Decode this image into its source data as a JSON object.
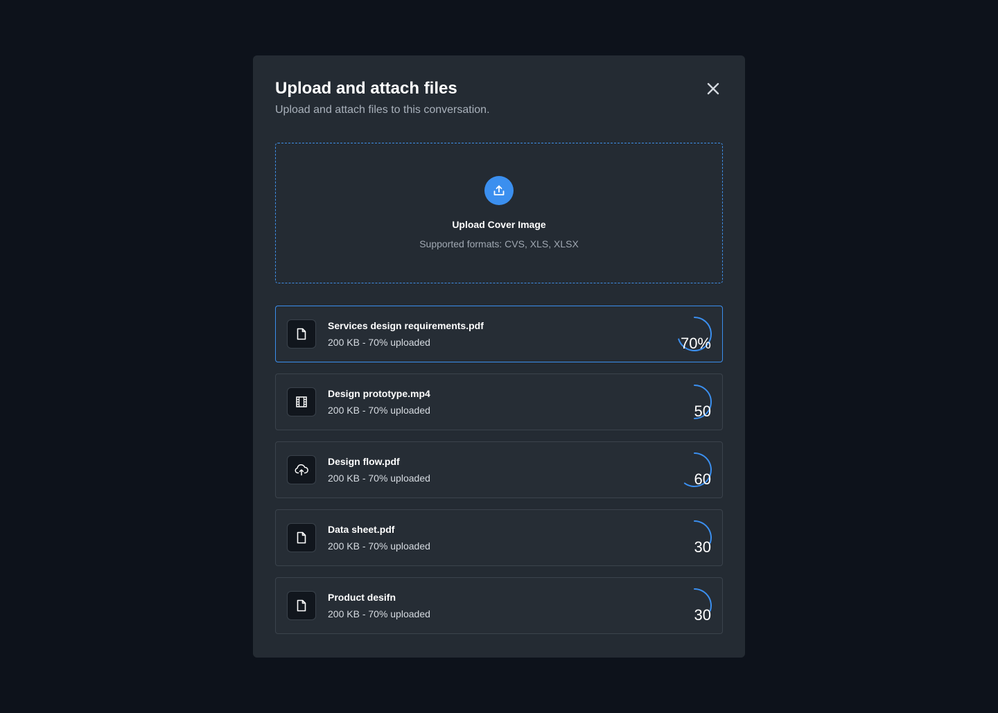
{
  "modal": {
    "title": "Upload and attach files",
    "subtitle": "Upload and attach files to this conversation.",
    "close_icon": "close-icon"
  },
  "dropzone": {
    "icon": "upload-icon",
    "title": "Upload Cover Image",
    "formats": "Supported formats: CVS, XLS, XLSX"
  },
  "colors": {
    "accent": "#3b8fef",
    "background": "#0d121b",
    "modal": "#242b33"
  },
  "files": [
    {
      "name": "Services design requirements.pdf",
      "meta": "200 KB - 70% uploaded",
      "icon": "document-icon",
      "progress_label": "70%",
      "progress": 70,
      "active": true
    },
    {
      "name": "Design prototype.mp4",
      "meta": "200 KB - 70% uploaded",
      "icon": "film-icon",
      "progress_label": "50",
      "progress": 50,
      "active": false
    },
    {
      "name": "Design flow.pdf",
      "meta": "200 KB - 70% uploaded",
      "icon": "cloud-upload-icon",
      "progress_label": "60",
      "progress": 60,
      "active": false
    },
    {
      "name": "Data sheet.pdf",
      "meta": "200 KB - 70% uploaded",
      "icon": "document-icon",
      "progress_label": "30",
      "progress": 30,
      "active": false
    },
    {
      "name": "Product desifn",
      "meta": "200 KB - 70% uploaded",
      "icon": "document-icon",
      "progress_label": "30",
      "progress": 30,
      "active": false
    }
  ]
}
